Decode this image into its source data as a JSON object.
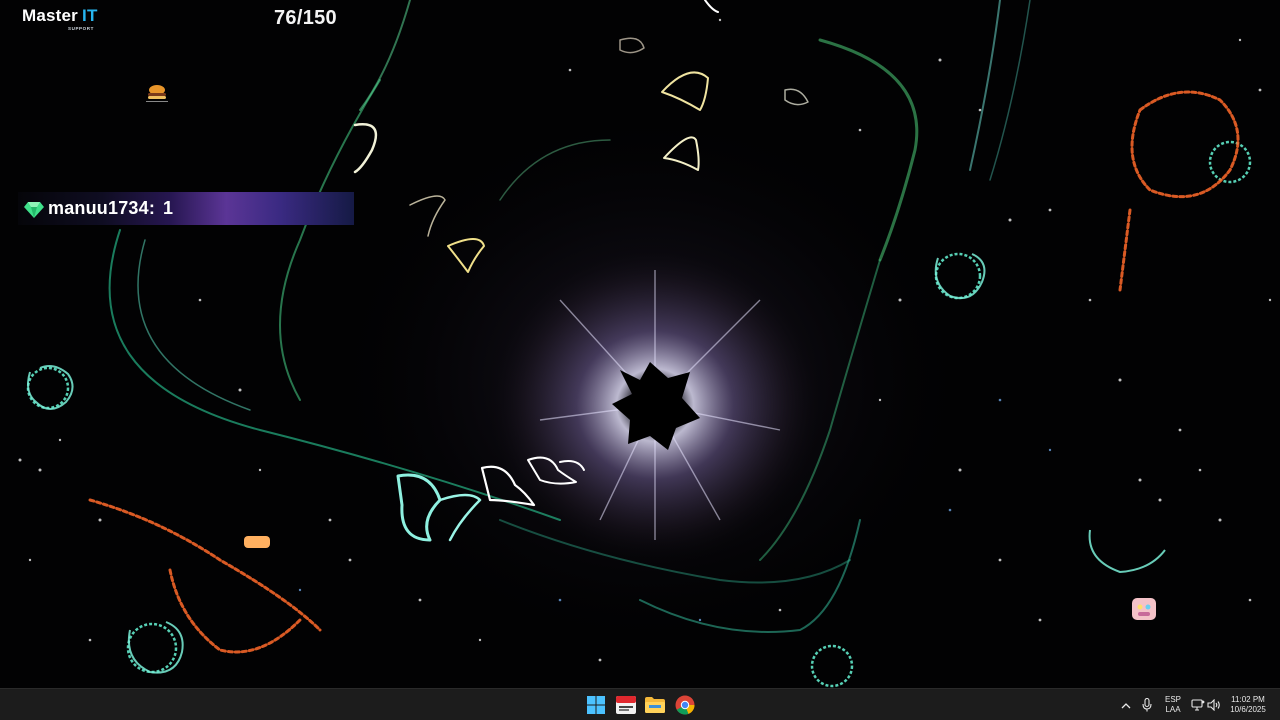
{
  "overlay": {
    "logo": {
      "main": "Master",
      "accent": "IT",
      "sub": "SUPPORT"
    },
    "counter": "76/150",
    "leaderboard": {
      "icon": "diamond-icon",
      "user": "manuu1734:",
      "score": "1"
    }
  },
  "taskbar": {
    "apps": [
      "windows-start-icon",
      "tiktok-live-studio-icon",
      "file-explorer-icon",
      "chrome-icon"
    ],
    "tray": {
      "overflow_icon": "chevron-up-icon",
      "mic_icon": "microphone-icon",
      "language": {
        "line1": "ESP",
        "line2": "LAA"
      },
      "network_icon": "network-icon",
      "volume_icon": "speaker-icon",
      "time": "11:02 PM",
      "date": "10/6/2025"
    }
  },
  "colors": {
    "cyan_glow": "#5fe6c8",
    "orange_glow": "#ff6a2a",
    "banner_purple": "#5b3596",
    "logo_accent": "#27b5f0",
    "taskbar_bg": "#1c1c1c"
  }
}
